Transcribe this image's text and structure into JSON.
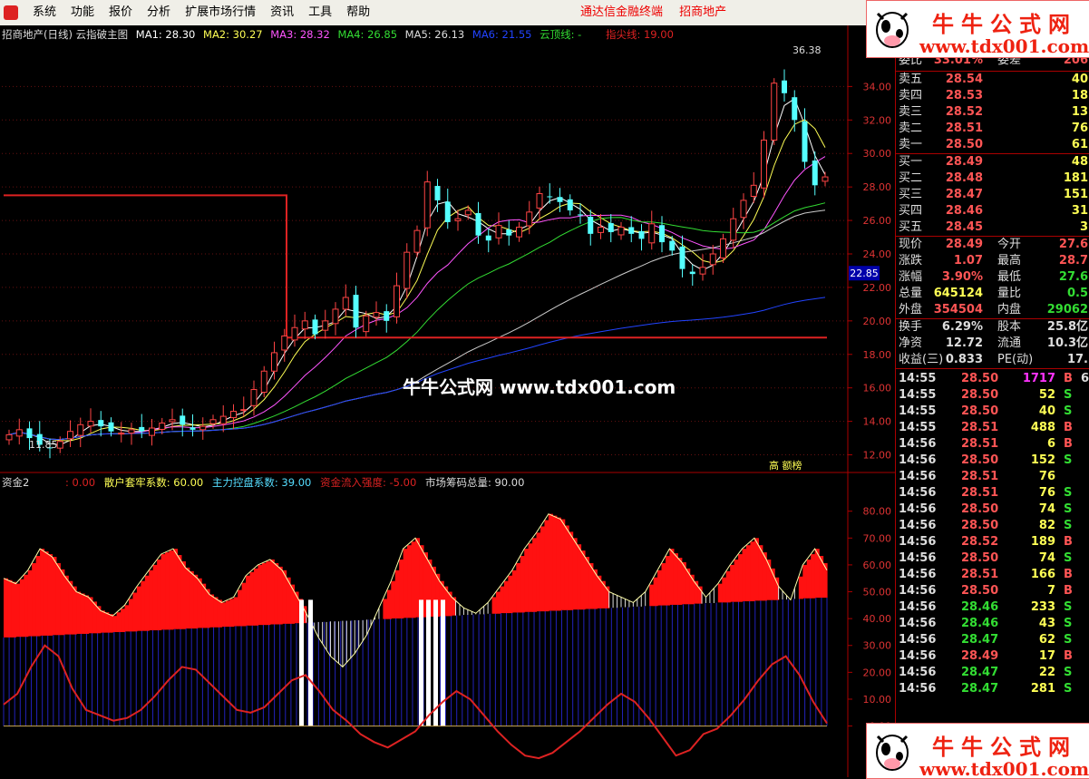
{
  "menubar": {
    "items": [
      "系统",
      "功能",
      "报价",
      "分析",
      "扩展市场行情",
      "资讯",
      "工具",
      "帮助"
    ],
    "broker": "通达信金融终端",
    "stock": "招商地产"
  },
  "logo": {
    "name": "牛牛公式网",
    "url": "www.tdx001.com"
  },
  "main_info": {
    "title": "招商地产(日线) 云指破主图",
    "ma1": "MA1: 28.30",
    "ma2": "MA2: 30.27",
    "ma3": "MA3: 28.32",
    "ma4": "MA4: 26.85",
    "ma5": "MA5: 26.13",
    "ma6": "MA6: 21.55",
    "cloud_top": "云顶线: -",
    "peak_line": "指尖线: 19.00"
  },
  "watermark": "牛牛公式网 www.tdx001.com",
  "price_labels": {
    "high": "36.38",
    "low": "11.85",
    "cursor": "22.85",
    "badge": "高 额榜"
  },
  "sub_info": {
    "title": "资金2",
    "v0": ": 0.00",
    "retail": "散户套牢系数: 60.00",
    "main": "主力控盘系数: 39.00",
    "inflow": "资金流入强度: -5.00",
    "chips": "市场筹码总量: 90.00"
  },
  "chart_data": [
    {
      "type": "candlestick",
      "title": "招商地产(日线) 云指破主图",
      "ylim": [
        11,
        37
      ],
      "y_ticks": [
        "34.00",
        "32.00",
        "30.00",
        "28.00",
        "26.00",
        "24.00",
        "22.00",
        "20.00",
        "18.00",
        "16.00",
        "14.00",
        "12.00"
      ],
      "horizontal_lines": [
        {
          "name": "指尖线",
          "value": 19.0,
          "color": "#dd2222"
        }
      ],
      "step_line": {
        "value_before": 27.5,
        "value_after": 19.0,
        "color": "#dd2222"
      },
      "close": [
        13.2,
        13.5,
        13.0,
        12.6,
        12.4,
        12.8,
        13.4,
        13.8,
        14.0,
        13.7,
        13.4,
        13.3,
        13.5,
        13.4,
        13.6,
        13.9,
        14.1,
        13.8,
        13.5,
        13.7,
        14.1,
        14.3,
        14.6,
        14.7,
        15.9,
        17.0,
        18.1,
        19.1,
        19.6,
        20.0,
        19.2,
        20.0,
        20.7,
        21.4,
        19.6,
        20.3,
        20.5,
        20.0,
        22.1,
        24.1,
        25.4,
        28.3,
        27.2,
        25.9,
        26.1,
        26.6,
        25.1,
        24.8,
        25.7,
        25.1,
        25.6,
        26.5,
        27.6,
        27.4,
        27.1,
        26.6,
        26.3,
        25.2,
        25.6,
        25.3,
        25.6,
        25.2,
        24.9,
        25.8,
        24.7,
        24.2,
        23.1,
        22.8,
        23.2,
        24.0,
        24.9,
        26.1,
        27.2,
        28.1,
        30.8,
        34.2,
        33.6,
        32.0,
        29.5,
        28.1,
        28.6
      ],
      "ma_series": [
        {
          "name": "MA1",
          "color": "#ffffff"
        },
        {
          "name": "MA2",
          "color": "#ffff55"
        },
        {
          "name": "MA3",
          "color": "#ff55ff"
        },
        {
          "name": "MA4",
          "color": "#33dd33"
        },
        {
          "name": "MA5",
          "color": "#cccccc"
        },
        {
          "name": "MA6",
          "color": "#2244ff"
        }
      ]
    },
    {
      "type": "area",
      "title": "资金2",
      "ylim": [
        -15,
        88
      ],
      "y_ticks": [
        "80.00",
        "70.00",
        "60.00",
        "50.00",
        "40.00",
        "30.00",
        "20.00",
        "10.00",
        "0.00"
      ],
      "series": [
        {
          "name": "散户套牢系数",
          "values": [
            55,
            53,
            58,
            66,
            63,
            56,
            50,
            48,
            43,
            41,
            45,
            52,
            58,
            64,
            66,
            59,
            55,
            49,
            46,
            48,
            56,
            60,
            62,
            58,
            50,
            42,
            33,
            26,
            22,
            27,
            34,
            44,
            54,
            66,
            70,
            62,
            54,
            48,
            44,
            42,
            46,
            52,
            58,
            66,
            72,
            79,
            77,
            70,
            63,
            56,
            50,
            48,
            46,
            50,
            58,
            66,
            61,
            54,
            48,
            53,
            60,
            66,
            70,
            62,
            52,
            47,
            60,
            66,
            58
          ],
          "color": "#cccccc"
        },
        {
          "name": "主力控盘系数",
          "values": [
            8,
            12,
            22,
            30,
            26,
            14,
            6,
            4,
            2,
            3,
            6,
            11,
            17,
            22,
            21,
            16,
            11,
            6,
            5,
            7,
            12,
            17,
            19,
            13,
            6,
            2,
            -3,
            -6,
            -8,
            -5,
            -2,
            4,
            9,
            13,
            10,
            4,
            -2,
            -7,
            -11,
            -12,
            -10,
            -6,
            -2,
            3,
            8,
            12,
            9,
            3,
            -4,
            -11,
            -9,
            -3,
            -1,
            4,
            10,
            17,
            23,
            26,
            19,
            9,
            1
          ],
          "color": "#dd2222"
        },
        {
          "name": "市场筹码总量",
          "color": "#2222bb"
        }
      ]
    }
  ],
  "quote": {
    "top_partial": {
      "lbl": "委比",
      "val": "33.01%",
      "lbl2": "委差",
      "val2": "206"
    },
    "sell": [
      {
        "lbl": "卖五",
        "price": "28.54",
        "vol": "40"
      },
      {
        "lbl": "卖四",
        "price": "28.53",
        "vol": "18"
      },
      {
        "lbl": "卖三",
        "price": "28.52",
        "vol": "13"
      },
      {
        "lbl": "卖二",
        "price": "28.51",
        "vol": "76"
      },
      {
        "lbl": "卖一",
        "price": "28.50",
        "vol": "61"
      }
    ],
    "buy": [
      {
        "lbl": "买一",
        "price": "28.49",
        "vol": "48"
      },
      {
        "lbl": "买二",
        "price": "28.48",
        "vol": "181"
      },
      {
        "lbl": "买三",
        "price": "28.47",
        "vol": "151"
      },
      {
        "lbl": "买四",
        "price": "28.46",
        "vol": "31"
      },
      {
        "lbl": "买五",
        "price": "28.45",
        "vol": "3"
      }
    ],
    "stats": [
      {
        "lbl": "现价",
        "val": "28.49",
        "lbl2": "今开",
        "val2": "27.6"
      },
      {
        "lbl": "涨跌",
        "val": "1.07",
        "lbl2": "最高",
        "val2": "28.7"
      },
      {
        "lbl": "涨幅",
        "val": "3.90%",
        "lbl2": "最低",
        "val2": "27.6"
      },
      {
        "lbl": "总量",
        "val": "645124",
        "lbl2": "量比",
        "val2": "0.5"
      },
      {
        "lbl": "外盘",
        "val": "354504",
        "lbl2": "内盘",
        "val2": "29062"
      }
    ],
    "stats2": [
      {
        "lbl": "换手",
        "val": "6.29%",
        "lbl2": "股本",
        "val2": "25.8亿"
      },
      {
        "lbl": "净资",
        "val": "12.72",
        "lbl2": "流通",
        "val2": "10.3亿"
      },
      {
        "lbl": "收益(三)",
        "val": "0.833",
        "lbl2": "PE(动)",
        "val2": "17."
      }
    ],
    "ticks": [
      {
        "t": "14:55",
        "p": "28.50",
        "v": "1717",
        "bs": "B",
        "x": "6"
      },
      {
        "t": "14:55",
        "p": "28.50",
        "v": "52",
        "bs": "S",
        "x": ""
      },
      {
        "t": "14:55",
        "p": "28.50",
        "v": "40",
        "bs": "S",
        "x": ""
      },
      {
        "t": "14:55",
        "p": "28.51",
        "v": "488",
        "bs": "B",
        "x": ""
      },
      {
        "t": "14:56",
        "p": "28.51",
        "v": "6",
        "bs": "B",
        "x": ""
      },
      {
        "t": "14:56",
        "p": "28.50",
        "v": "152",
        "bs": "S",
        "x": ""
      },
      {
        "t": "14:56",
        "p": "28.51",
        "v": "76",
        "bs": "",
        "x": ""
      },
      {
        "t": "14:56",
        "p": "28.51",
        "v": "76",
        "bs": "S",
        "x": ""
      },
      {
        "t": "14:56",
        "p": "28.50",
        "v": "74",
        "bs": "S",
        "x": ""
      },
      {
        "t": "14:56",
        "p": "28.50",
        "v": "82",
        "bs": "S",
        "x": ""
      },
      {
        "t": "14:56",
        "p": "28.52",
        "v": "189",
        "bs": "B",
        "x": ""
      },
      {
        "t": "14:56",
        "p": "28.50",
        "v": "74",
        "bs": "S",
        "x": ""
      },
      {
        "t": "14:56",
        "p": "28.51",
        "v": "166",
        "bs": "B",
        "x": ""
      },
      {
        "t": "14:56",
        "p": "28.50",
        "v": "7",
        "bs": "B",
        "x": ""
      },
      {
        "t": "14:56",
        "p": "28.46",
        "v": "233",
        "bs": "S",
        "x": ""
      },
      {
        "t": "14:56",
        "p": "28.46",
        "v": "43",
        "bs": "S",
        "x": ""
      },
      {
        "t": "14:56",
        "p": "28.47",
        "v": "62",
        "bs": "S",
        "x": ""
      },
      {
        "t": "14:56",
        "p": "28.49",
        "v": "17",
        "bs": "B",
        "x": ""
      },
      {
        "t": "14:56",
        "p": "28.47",
        "v": "22",
        "bs": "S",
        "x": ""
      },
      {
        "t": "14:56",
        "p": "28.47",
        "v": "281",
        "bs": "S",
        "x": ""
      }
    ]
  }
}
